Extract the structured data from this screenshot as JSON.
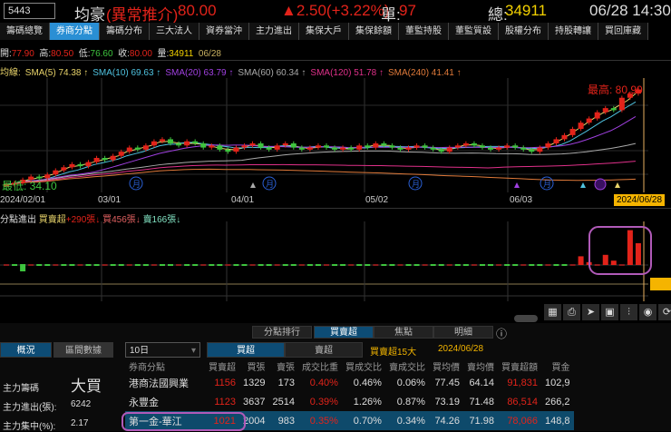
{
  "header": {
    "code": "5443",
    "name": "均豪",
    "status": "(異常推介)",
    "price": "80.00",
    "change": "▲2.50(+3.22%)",
    "unit_label": "單:",
    "unit": "97",
    "total_label": "總:",
    "total": "34911",
    "datetime": "06/28 14:30"
  },
  "tabs": [
    "籌碼總覽",
    "券商分點",
    "籌碼分布",
    "三大法人",
    "資券當沖",
    "主力進出",
    "集保大戶",
    "集保餘額",
    "董監持股",
    "董監質設",
    "股權分布",
    "持股轉讓",
    "買回庫藏"
  ],
  "active_tab": 1,
  "ohlc": {
    "open_label": "開:",
    "open": "77.90",
    "high_label": "高:",
    "high": "80.50",
    "low_label": "低:",
    "low": "76.60",
    "close_label": "收:",
    "close": "80.00",
    "vol_label": "量:",
    "vol": "34911",
    "date": "06/28"
  },
  "sma": {
    "prefix": "均線:",
    "items": [
      {
        "t": "SMA(5) 74.38 ↑",
        "c": "#e8d36a"
      },
      {
        "t": "SMA(10) 69.63 ↑",
        "c": "#4fc3e0"
      },
      {
        "t": "SMA(20) 63.79 ↑",
        "c": "#a040e0"
      },
      {
        "t": "SMA(60) 60.34 ↑",
        "c": "#aaaaaa"
      },
      {
        "t": "SMA(120) 51.78 ↑",
        "c": "#e0308a"
      },
      {
        "t": "SMA(240) 41.41 ↑",
        "c": "#e07a3a"
      }
    ]
  },
  "chart_data": {
    "type": "candlestick",
    "high_label": "最高: 80.90",
    "low_label": "最低: 34.10",
    "ylim": [
      33,
      82
    ],
    "x_ticks": [
      "2024/02/01",
      "03/01",
      "04/01",
      "05/02",
      "06/03"
    ],
    "current_date": "2024/06/28",
    "closes": [
      34.1,
      35,
      36.5,
      38,
      37.2,
      39,
      41,
      42.5,
      44,
      43,
      45,
      47,
      46,
      48,
      50,
      52,
      51,
      53,
      55,
      56,
      54,
      53,
      55,
      54,
      52,
      53,
      51,
      50,
      52,
      53,
      54,
      52,
      51,
      53,
      54,
      52,
      51,
      52,
      53,
      52,
      51,
      52,
      51,
      53,
      52,
      54,
      53,
      52,
      51,
      52,
      53,
      52,
      51,
      50,
      52,
      53,
      54,
      53,
      52,
      51,
      52,
      53,
      52,
      51,
      50,
      52,
      54,
      56,
      58,
      61,
      64,
      66,
      69,
      71,
      70,
      76,
      78,
      80
    ],
    "sub_series": [
      0,
      0,
      -1,
      0,
      0,
      0,
      0,
      0,
      0,
      0,
      0,
      0,
      0,
      0,
      0,
      0,
      0,
      0,
      0,
      0,
      0,
      0,
      0,
      0,
      0,
      0,
      0,
      0,
      0,
      0,
      0,
      0,
      0,
      0,
      0,
      0,
      0,
      0,
      0,
      0,
      0,
      0,
      0,
      0,
      0,
      0,
      0,
      0,
      0,
      0,
      0,
      0,
      0,
      0,
      0,
      0,
      0,
      0,
      0,
      0,
      0,
      0,
      0,
      0,
      0,
      0,
      0,
      0,
      0,
      0,
      6,
      2,
      0,
      7,
      3,
      0,
      24,
      15
    ]
  },
  "sub": {
    "title": "分點進出",
    "net_label": "買賣超",
    "net": "+290張↓",
    "buy": "買456張↓",
    "sell": "賣166張↓"
  },
  "toolbar": [
    "▦",
    "⎙",
    "➤",
    "▣",
    "⫶",
    "◉",
    "⟳"
  ],
  "panel": {
    "tabs": [
      "分點排行",
      "買賣超",
      "焦點",
      "明細"
    ],
    "active": 1,
    "info": "ⓘ",
    "left_tabs": [
      "概況",
      "區間數據"
    ],
    "period": "10日",
    "mode": [
      "買超",
      "賣超"
    ],
    "title": "買賣超15大",
    "date": "2024/06/28",
    "stats": [
      {
        "l": "主力籌碼",
        "v": "大買"
      },
      {
        "l": "主力進出(張):",
        "v": "6242"
      },
      {
        "l": "主力集中(%):",
        "v": "2.17"
      }
    ],
    "columns": [
      "券商分點",
      "買賣超",
      "買張",
      "賣張",
      "成交比重",
      "買成交比",
      "賣成交比",
      "買均價",
      "賣均價",
      "買賣超額",
      "買金"
    ],
    "rows": [
      [
        "港商法國興業",
        "1156",
        "1329",
        "173",
        "0.40%",
        "0.46%",
        "0.06%",
        "77.45",
        "64.14",
        "91,831",
        "102,9"
      ],
      [
        "永豐金",
        "1123",
        "3637",
        "2514",
        "0.39%",
        "1.26%",
        "0.87%",
        "73.19",
        "71.48",
        "86,514",
        "266,2"
      ],
      [
        "第一金-華江",
        "1021",
        "2004",
        "983",
        "0.35%",
        "0.70%",
        "0.34%",
        "74.26",
        "71.98",
        "78,066",
        "148,8"
      ]
    ]
  }
}
